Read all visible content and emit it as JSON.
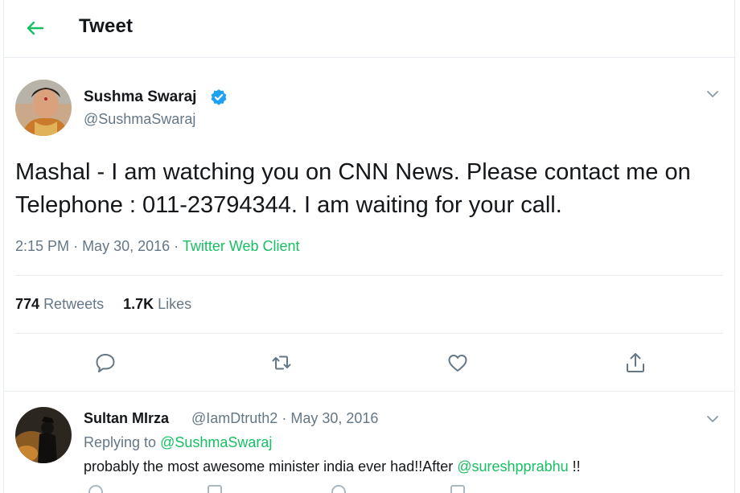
{
  "header": {
    "title": "Tweet",
    "back_icon": "arrow-left-icon",
    "accent": "#17bf63"
  },
  "tweet": {
    "author_name": "Sushma Swaraj",
    "author_handle": "@SushmaSwaraj",
    "verified": true,
    "text": "Mashal - I  am watching you on CNN News. Please contact me on Telephone : 011-23794344. I am waiting for your call.",
    "time": "2:15 PM",
    "date": "May 30, 2016",
    "client": "Twitter Web Client",
    "retweets_count": "774",
    "retweets_label": "Retweets",
    "likes_count": "1.7K",
    "likes_label": "Likes",
    "actions": [
      "reply-icon",
      "retweet-icon",
      "like-icon",
      "share-icon"
    ]
  },
  "reply": {
    "author_name": "Sultan MIrza",
    "author_handle": "@IamDtruth2",
    "date": "May 30, 2016",
    "replying_label": "Replying to",
    "replying_to": "@SushmaSwaraj",
    "text_before": "probably the most awesome minister india ever had!!After",
    "mention": "@sureshpprabhu",
    "text_after": "!!"
  },
  "colors": {
    "text_primary": "#14171a",
    "text_secondary": "#657786",
    "link_green": "#17bf63",
    "verified_blue": "#1da1f2",
    "divider": "#e6ecf0"
  }
}
